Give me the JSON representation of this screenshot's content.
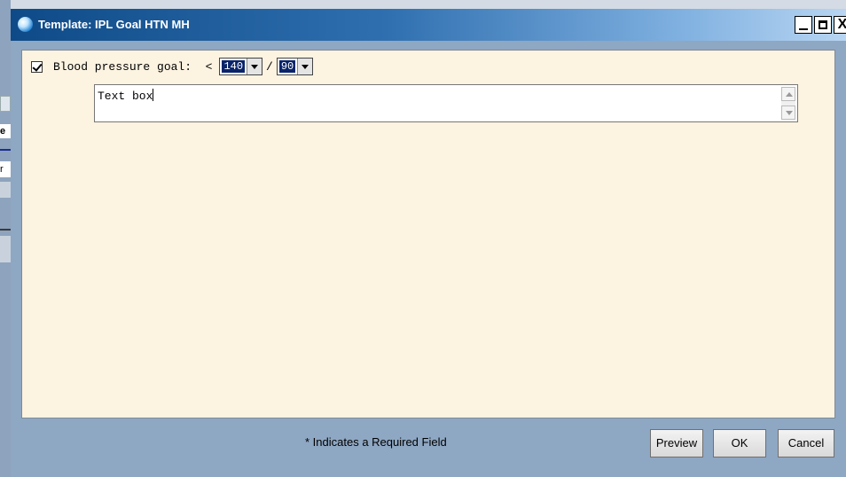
{
  "background": {
    "strip_char_1": "e",
    "strip_char_2": "r"
  },
  "window": {
    "title": "Template: IPL Goal HTN MH",
    "controls": {
      "close_label": "X"
    }
  },
  "form": {
    "goal_checked": true,
    "goal_label": "Blood pressure goal:  <",
    "systolic": "140",
    "separator": "/",
    "diastolic": "90",
    "textbox_value": "Text box"
  },
  "footer": {
    "note": "* Indicates a Required Field",
    "preview_label": "Preview",
    "ok_label": "OK",
    "cancel_label": "Cancel"
  },
  "colors": {
    "content_bg": "#fcf3e1",
    "frame_bg": "#8ea7c3",
    "selection": "#0a246a"
  }
}
